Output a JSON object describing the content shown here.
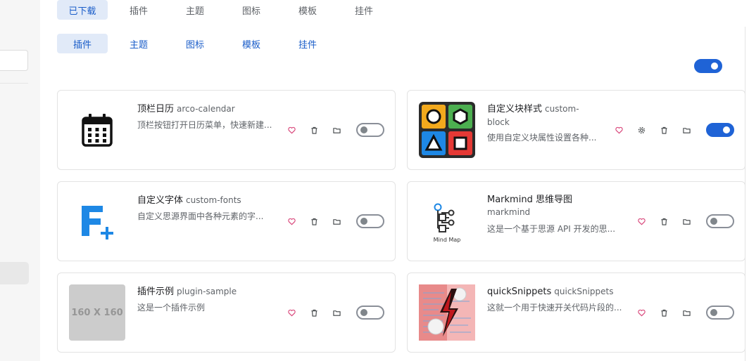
{
  "top_tabs": [
    {
      "label": "已下载",
      "active": true
    },
    {
      "label": "插件",
      "active": false
    },
    {
      "label": "主题",
      "active": false
    },
    {
      "label": "图标",
      "active": false
    },
    {
      "label": "模板",
      "active": false
    },
    {
      "label": "挂件",
      "active": false
    }
  ],
  "sub_tabs": [
    {
      "label": "插件",
      "active": true
    },
    {
      "label": "主题",
      "active": false
    },
    {
      "label": "图标",
      "active": false
    },
    {
      "label": "模板",
      "active": false
    },
    {
      "label": "挂件",
      "active": false
    }
  ],
  "master_toggle": {
    "on": true
  },
  "plugins": [
    {
      "name": "顶栏日历",
      "package": "arco-calendar",
      "description": "顶栏按钮打开日历菜单，快速新建...",
      "icon": "calendar-icon",
      "has_settings": false,
      "enabled": false
    },
    {
      "name": "自定义块样式",
      "package": "custom-block",
      "description": "使用自定义块属性设置各种...",
      "icon": "shapes-grid-icon",
      "has_settings": true,
      "enabled": true
    },
    {
      "name": "自定义字体",
      "package": "custom-fonts",
      "description": "自定义思源界面中各种元素的字...",
      "icon": "font-f-plus-icon",
      "has_settings": false,
      "enabled": false
    },
    {
      "name": "Markmind 思维导图",
      "package": "markmind",
      "description": "这是一个基于思源 API 开发的思...",
      "icon": "mind-map-icon",
      "icon_caption": "Mind Map",
      "has_settings": false,
      "enabled": false
    },
    {
      "name": "插件示例",
      "package": "plugin-sample",
      "description": "这是一个插件示例",
      "icon": "placeholder-image-icon",
      "icon_caption": "160 X 160",
      "has_settings": false,
      "enabled": false
    },
    {
      "name": "quickSnippets",
      "package": "quickSnippets",
      "description": "这就一个用于快速开关代码片段的...",
      "icon": "lightning-snippets-icon",
      "has_settings": false,
      "enabled": false
    }
  ],
  "colors": {
    "accent": "#1f63d6",
    "tab_active_bg": "#e1eaf8",
    "heart": "#d9467a"
  }
}
